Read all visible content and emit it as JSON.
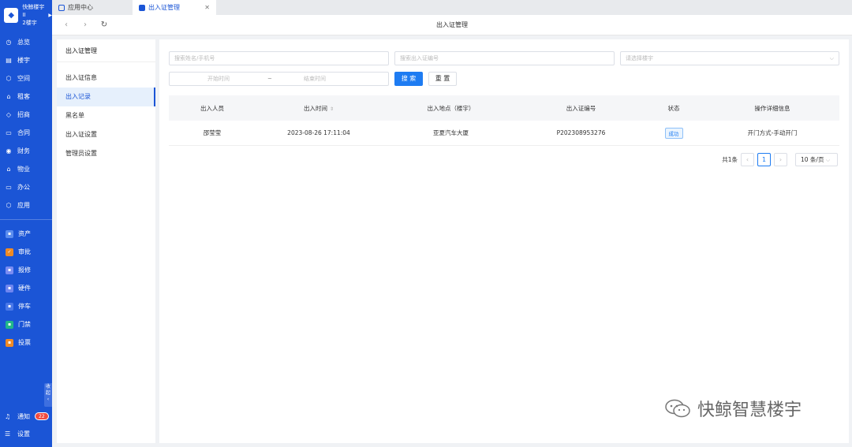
{
  "brand": {
    "name": "快鲸楼宇II",
    "building": "2楼宇"
  },
  "nav": [
    {
      "icon": "clock-icon",
      "label": "总览"
    },
    {
      "icon": "building-icon",
      "label": "楼宇"
    },
    {
      "icon": "cube-icon",
      "label": "空间"
    },
    {
      "icon": "home-icon",
      "label": "租客"
    },
    {
      "icon": "handshake-icon",
      "label": "招商"
    },
    {
      "icon": "document-icon",
      "label": "合同"
    },
    {
      "icon": "coin-icon",
      "label": "财务"
    },
    {
      "icon": "house-icon",
      "label": "物业"
    },
    {
      "icon": "monitor-icon",
      "label": "办公"
    },
    {
      "icon": "app-icon",
      "label": "应用"
    }
  ],
  "apps": [
    {
      "label": "资产",
      "color": "#5b8def"
    },
    {
      "label": "审批",
      "color": "#f08a24"
    },
    {
      "label": "报修",
      "color": "#7a8cf2"
    },
    {
      "label": "硬件",
      "color": "#6f86f0"
    },
    {
      "label": "停车",
      "color": "#4a78e8"
    },
    {
      "label": "门禁",
      "color": "#21b68a"
    },
    {
      "label": "投票",
      "color": "#f08a24"
    }
  ],
  "collapse_label": "收起",
  "bottom": {
    "notify_label": "通知",
    "notify_count": "22",
    "settings_label": "设置"
  },
  "tabs": [
    {
      "label": "应用中心",
      "active": false
    },
    {
      "label": "出入证管理",
      "active": true
    }
  ],
  "toolbar": {
    "title": "出入证管理"
  },
  "submenu": {
    "title": "出入证管理",
    "items": [
      "出入证信息",
      "出入记录",
      "黑名单",
      "出入证设置",
      "管理员设置"
    ],
    "active_index": 1
  },
  "filters": {
    "name_placeholder": "搜索姓名/手机号",
    "pass_no_placeholder": "搜索出入证编号",
    "building_placeholder": "请选择楼宇",
    "start_placeholder": "开始时间",
    "range_sep": "~",
    "end_placeholder": "结束时间",
    "search_label": "搜 索",
    "reset_label": "重 置"
  },
  "table": {
    "headers": [
      "出入人员",
      "出入时间",
      "出入地点（楼宇）",
      "出入证编号",
      "状态",
      "操作详细信息"
    ],
    "rows": [
      [
        "邵莹莹",
        "2023-08-26 17:11:04",
        "亚夏汽车大厦",
        "P202308953276",
        "成功",
        "开门方式-手动开门"
      ]
    ]
  },
  "pagination": {
    "total_label": "共1条",
    "current_page": "1",
    "page_size": "10 条/页"
  },
  "footer_mark": "快鲸智慧楼宇"
}
